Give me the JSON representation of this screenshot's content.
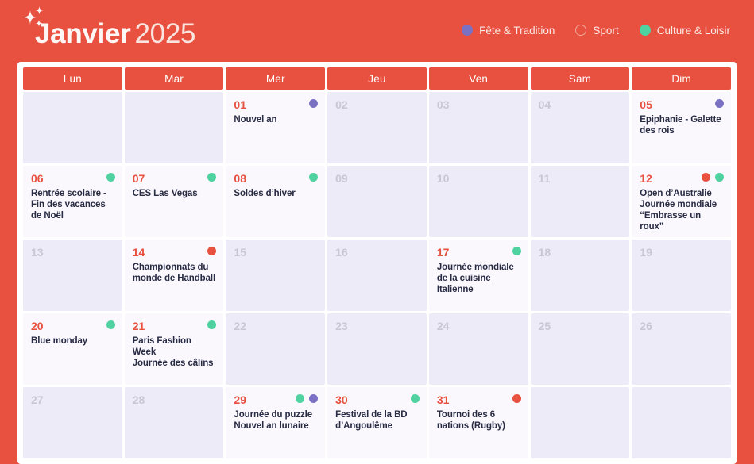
{
  "header": {
    "month": "Janvier",
    "year": "2025",
    "sparkle_icon": "sparkles-icon",
    "legend": [
      {
        "label": "Fête & Tradition",
        "style": "fete",
        "color": "#7a71c4"
      },
      {
        "label": "Sport",
        "style": "sport",
        "color": "#e8503f"
      },
      {
        "label": "Culture & Loisir",
        "style": "culture",
        "color": "#4fd2a0"
      }
    ]
  },
  "calendar": {
    "day_headers": [
      "Lun",
      "Mar",
      "Mer",
      "Jeu",
      "Ven",
      "Sam",
      "Dim"
    ],
    "weeks": [
      [
        {
          "num": "",
          "events": [],
          "dots": [],
          "state": "blank"
        },
        {
          "num": "",
          "events": [],
          "dots": [],
          "state": "blank"
        },
        {
          "num": "01",
          "events": [
            "Nouvel an"
          ],
          "dots": [
            "purple"
          ],
          "state": "event"
        },
        {
          "num": "02",
          "events": [],
          "dots": [],
          "state": "shaded"
        },
        {
          "num": "03",
          "events": [],
          "dots": [],
          "state": "shaded"
        },
        {
          "num": "04",
          "events": [],
          "dots": [],
          "state": "shaded"
        },
        {
          "num": "05",
          "events": [
            "Epiphanie - Galette des rois"
          ],
          "dots": [
            "purple"
          ],
          "state": "event"
        }
      ],
      [
        {
          "num": "06",
          "events": [
            "Rentrée scolaire - Fin des vacances de Noël"
          ],
          "dots": [
            "green"
          ],
          "state": "event"
        },
        {
          "num": "07",
          "events": [
            "CES Las Vegas"
          ],
          "dots": [
            "green"
          ],
          "state": "event"
        },
        {
          "num": "08",
          "events": [
            "Soldes d’hiver"
          ],
          "dots": [
            "green"
          ],
          "state": "event"
        },
        {
          "num": "09",
          "events": [],
          "dots": [],
          "state": "shaded"
        },
        {
          "num": "10",
          "events": [],
          "dots": [],
          "state": "shaded"
        },
        {
          "num": "11",
          "events": [],
          "dots": [],
          "state": "shaded"
        },
        {
          "num": "12",
          "events": [
            "Open d’Australie",
            "Journée mondiale “Embrasse un roux”"
          ],
          "dots": [
            "red",
            "green"
          ],
          "state": "event"
        }
      ],
      [
        {
          "num": "13",
          "events": [],
          "dots": [],
          "state": "shaded"
        },
        {
          "num": "14",
          "events": [
            "Championnats du monde de Handball"
          ],
          "dots": [
            "red"
          ],
          "state": "event"
        },
        {
          "num": "15",
          "events": [],
          "dots": [],
          "state": "shaded"
        },
        {
          "num": "16",
          "events": [],
          "dots": [],
          "state": "shaded"
        },
        {
          "num": "17",
          "events": [
            "Journée mondiale de la cuisine Italienne"
          ],
          "dots": [
            "green"
          ],
          "state": "event"
        },
        {
          "num": "18",
          "events": [],
          "dots": [],
          "state": "shaded"
        },
        {
          "num": "19",
          "events": [],
          "dots": [],
          "state": "shaded"
        }
      ],
      [
        {
          "num": "20",
          "events": [
            "Blue monday"
          ],
          "dots": [
            "green"
          ],
          "state": "event"
        },
        {
          "num": "21",
          "events": [
            "Paris Fashion Week",
            "Journée des câlins"
          ],
          "dots": [
            "green"
          ],
          "state": "event"
        },
        {
          "num": "22",
          "events": [],
          "dots": [],
          "state": "shaded"
        },
        {
          "num": "23",
          "events": [],
          "dots": [],
          "state": "shaded"
        },
        {
          "num": "24",
          "events": [],
          "dots": [],
          "state": "shaded"
        },
        {
          "num": "25",
          "events": [],
          "dots": [],
          "state": "shaded"
        },
        {
          "num": "26",
          "events": [],
          "dots": [],
          "state": "shaded"
        }
      ],
      [
        {
          "num": "27",
          "events": [],
          "dots": [],
          "state": "shaded"
        },
        {
          "num": "28",
          "events": [],
          "dots": [],
          "state": "shaded"
        },
        {
          "num": "29",
          "events": [
            "Journée du puzzle",
            "Nouvel an lunaire"
          ],
          "dots": [
            "green",
            "purple"
          ],
          "state": "event"
        },
        {
          "num": "30",
          "events": [
            "Festival de la BD d’Angoulême"
          ],
          "dots": [
            "green"
          ],
          "state": "event"
        },
        {
          "num": "31",
          "events": [
            "Tournoi des 6 nations (Rugby)"
          ],
          "dots": [
            "red"
          ],
          "state": "event"
        },
        {
          "num": "",
          "events": [],
          "dots": [],
          "state": "blank"
        },
        {
          "num": "",
          "events": [],
          "dots": [],
          "state": "blank"
        }
      ]
    ]
  },
  "colors": {
    "brand_red": "#e8503f",
    "purple": "#7a71c4",
    "green": "#4fd2a0",
    "cell_light": "#faf8fd",
    "cell_shaded": "#eeebf8",
    "event_text": "#282b44"
  }
}
